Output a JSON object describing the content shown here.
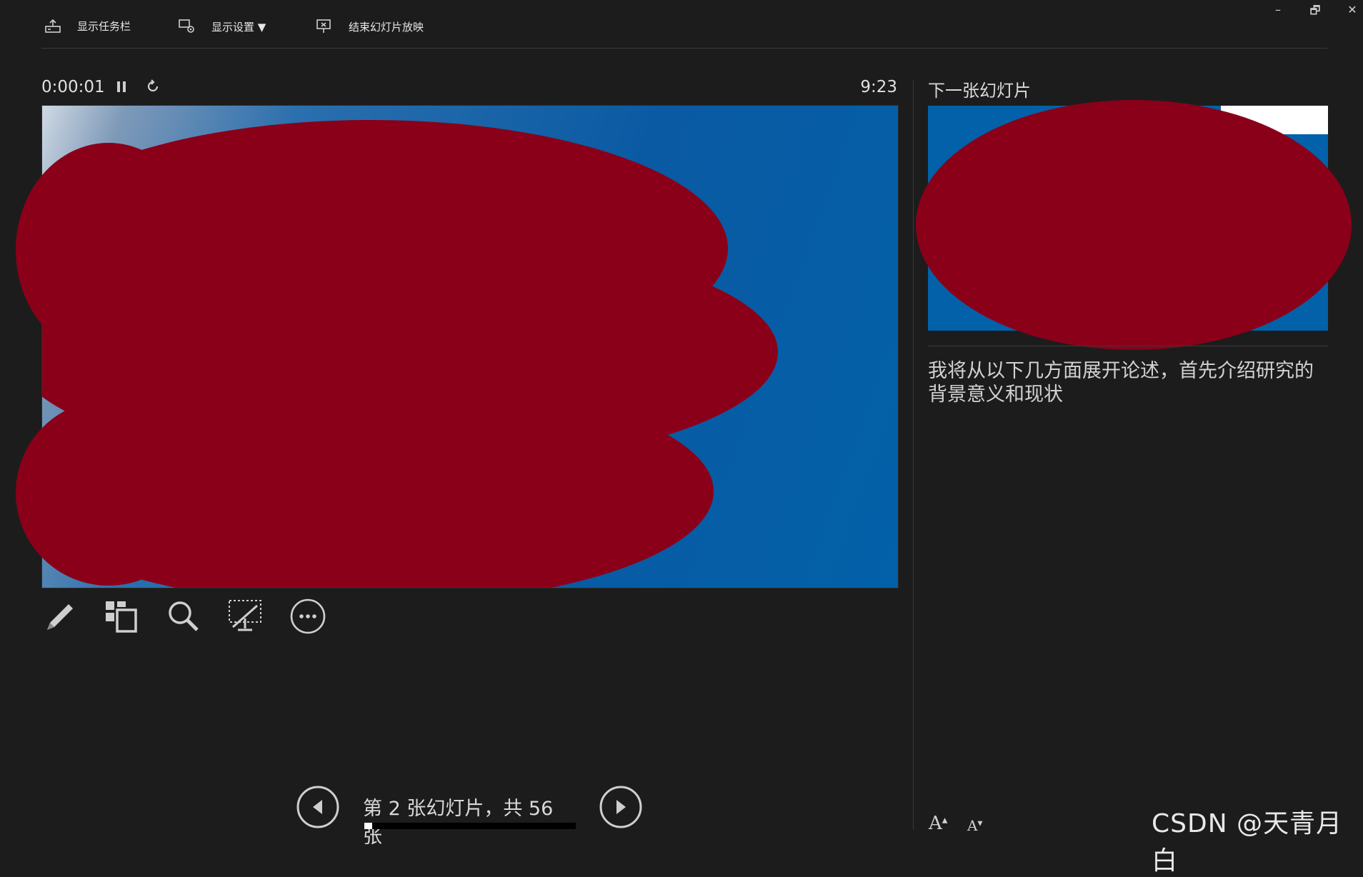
{
  "toolbar": {
    "show_taskbar": "显示任务栏",
    "display_settings": "显示设置 ▼",
    "end_slideshow": "结束幻灯片放映"
  },
  "window_controls": {
    "minimize": "–",
    "restore": "🗗",
    "close": "✕"
  },
  "timer": {
    "elapsed": "0:00:01",
    "clock": "9:23"
  },
  "next_slide": {
    "label": "下一张幻灯片"
  },
  "notes": {
    "text": "我将从以下几方面展开论述，首先介绍研究的背景意义和现状"
  },
  "navigation": {
    "counter": "第 2 张幻灯片，共 56 张",
    "current": 2,
    "total": 56,
    "progress_fraction": 0.036
  },
  "font_controls": {
    "increase": "A",
    "decrease": "A"
  },
  "watermark": "CSDN @天青月白",
  "colors": {
    "background": "#1c1c1c",
    "slide_blue": "#0261a8",
    "redaction": "#8a0019"
  }
}
